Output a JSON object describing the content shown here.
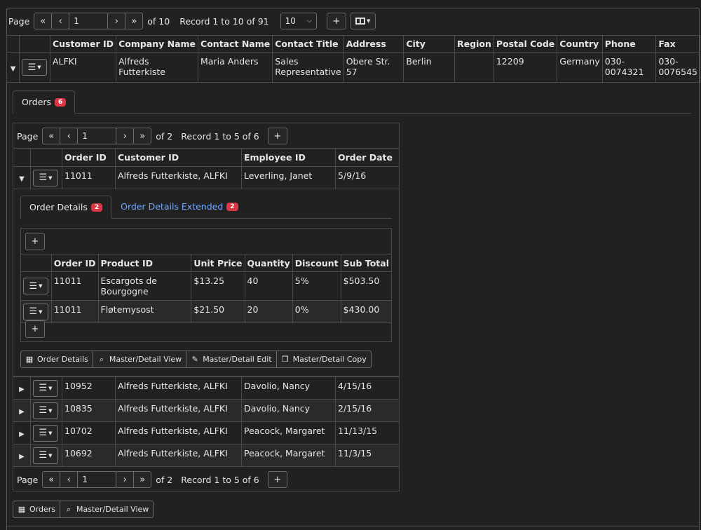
{
  "main_pager": {
    "page_label": "Page",
    "page_value": "1",
    "of_text": "of 10",
    "record_text": "Record 1 to 10 of 91",
    "page_size": "10",
    "add_label": "+",
    "first": "«",
    "prev": "‹",
    "next": "›",
    "last": "»"
  },
  "customers": {
    "columns": [
      "Customer ID",
      "Company Name",
      "Contact Name",
      "Contact Title",
      "Address",
      "City",
      "Region",
      "Postal Code",
      "Country",
      "Phone",
      "Fax"
    ],
    "row": {
      "customer_id": "ALFKI",
      "company_name": "Alfreds Futterkiste",
      "contact_name": "Maria Anders",
      "contact_title": "Sales Representative",
      "address": "Obere Str. 57",
      "city": "Berlin",
      "region": "",
      "postal_code": "12209",
      "country": "Germany",
      "phone": "030-0074321",
      "fax": "030-0076545"
    }
  },
  "orders_tab": {
    "label": "Orders",
    "count": "6"
  },
  "orders_pager": {
    "page_label": "Page",
    "page_value": "1",
    "of_text": "of 2",
    "record_text": "Record 1 to 5 of 6"
  },
  "orders": {
    "columns": [
      "Order ID",
      "Customer ID",
      "Employee ID",
      "Order Date"
    ],
    "rows": [
      {
        "order_id": "11011",
        "customer": "Alfreds Futterkiste, ALFKI",
        "employee": "Leverling, Janet",
        "date": "5/9/16"
      },
      {
        "order_id": "10952",
        "customer": "Alfreds Futterkiste, ALFKI",
        "employee": "Davolio, Nancy",
        "date": "4/15/16"
      },
      {
        "order_id": "10835",
        "customer": "Alfreds Futterkiste, ALFKI",
        "employee": "Davolio, Nancy",
        "date": "2/15/16"
      },
      {
        "order_id": "10702",
        "customer": "Alfreds Futterkiste, ALFKI",
        "employee": "Peacock, Margaret",
        "date": "11/13/15"
      },
      {
        "order_id": "10692",
        "customer": "Alfreds Futterkiste, ALFKI",
        "employee": "Peacock, Margaret",
        "date": "11/3/15"
      }
    ]
  },
  "detail_tabs": [
    {
      "label": "Order Details",
      "count": "2"
    },
    {
      "label": "Order Details Extended",
      "count": "2"
    }
  ],
  "details": {
    "columns": [
      "Order ID",
      "Product ID",
      "Unit Price",
      "Quantity",
      "Discount",
      "Sub Total"
    ],
    "rows": [
      {
        "order_id": "11011",
        "product": "Escargots de Bourgogne",
        "price": "$13.25",
        "qty": "40",
        "discount": "5%",
        "subtotal": "$503.50"
      },
      {
        "order_id": "11011",
        "product": "Fløtemysost",
        "price": "$21.50",
        "qty": "20",
        "discount": "0%",
        "subtotal": "$430.00"
      }
    ]
  },
  "detail_actions": [
    "Order Details",
    "Master/Detail View",
    "Master/Detail Edit",
    "Master/Detail Copy"
  ],
  "order_actions": [
    "Orders",
    "Master/Detail View"
  ],
  "colors": {
    "bg": "#212121",
    "border": "#4a4a4a",
    "badge": "#dc3545",
    "link": "#6ea8fe"
  }
}
